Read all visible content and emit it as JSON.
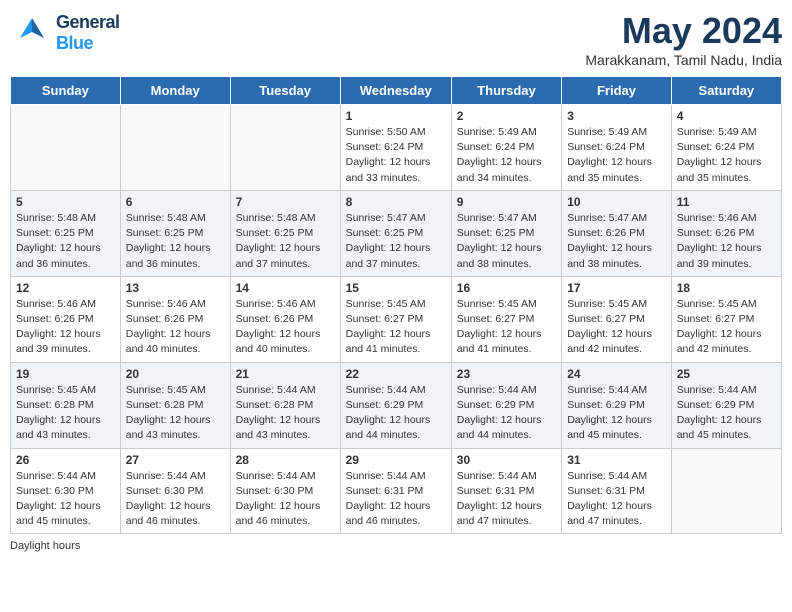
{
  "header": {
    "logo_line1": "General",
    "logo_line2": "Blue",
    "month_year": "May 2024",
    "location": "Marakkanam, Tamil Nadu, India"
  },
  "days_of_week": [
    "Sunday",
    "Monday",
    "Tuesday",
    "Wednesday",
    "Thursday",
    "Friday",
    "Saturday"
  ],
  "footer": {
    "daylight_label": "Daylight hours"
  },
  "weeks": [
    {
      "days": [
        {
          "num": "",
          "info": "",
          "week_class": "empty"
        },
        {
          "num": "",
          "info": "",
          "week_class": "empty"
        },
        {
          "num": "",
          "info": "",
          "week_class": "empty"
        },
        {
          "num": "1",
          "info": "Sunrise: 5:50 AM\nSunset: 6:24 PM\nDaylight: 12 hours\nand 33 minutes.",
          "week_class": "odd-week"
        },
        {
          "num": "2",
          "info": "Sunrise: 5:49 AM\nSunset: 6:24 PM\nDaylight: 12 hours\nand 34 minutes.",
          "week_class": "odd-week"
        },
        {
          "num": "3",
          "info": "Sunrise: 5:49 AM\nSunset: 6:24 PM\nDaylight: 12 hours\nand 35 minutes.",
          "week_class": "odd-week"
        },
        {
          "num": "4",
          "info": "Sunrise: 5:49 AM\nSunset: 6:24 PM\nDaylight: 12 hours\nand 35 minutes.",
          "week_class": "odd-week"
        }
      ]
    },
    {
      "days": [
        {
          "num": "5",
          "info": "Sunrise: 5:48 AM\nSunset: 6:25 PM\nDaylight: 12 hours\nand 36 minutes.",
          "week_class": "even-week"
        },
        {
          "num": "6",
          "info": "Sunrise: 5:48 AM\nSunset: 6:25 PM\nDaylight: 12 hours\nand 36 minutes.",
          "week_class": "even-week"
        },
        {
          "num": "7",
          "info": "Sunrise: 5:48 AM\nSunset: 6:25 PM\nDaylight: 12 hours\nand 37 minutes.",
          "week_class": "even-week"
        },
        {
          "num": "8",
          "info": "Sunrise: 5:47 AM\nSunset: 6:25 PM\nDaylight: 12 hours\nand 37 minutes.",
          "week_class": "even-week"
        },
        {
          "num": "9",
          "info": "Sunrise: 5:47 AM\nSunset: 6:25 PM\nDaylight: 12 hours\nand 38 minutes.",
          "week_class": "even-week"
        },
        {
          "num": "10",
          "info": "Sunrise: 5:47 AM\nSunset: 6:26 PM\nDaylight: 12 hours\nand 38 minutes.",
          "week_class": "even-week"
        },
        {
          "num": "11",
          "info": "Sunrise: 5:46 AM\nSunset: 6:26 PM\nDaylight: 12 hours\nand 39 minutes.",
          "week_class": "even-week"
        }
      ]
    },
    {
      "days": [
        {
          "num": "12",
          "info": "Sunrise: 5:46 AM\nSunset: 6:26 PM\nDaylight: 12 hours\nand 39 minutes.",
          "week_class": "odd-week"
        },
        {
          "num": "13",
          "info": "Sunrise: 5:46 AM\nSunset: 6:26 PM\nDaylight: 12 hours\nand 40 minutes.",
          "week_class": "odd-week"
        },
        {
          "num": "14",
          "info": "Sunrise: 5:46 AM\nSunset: 6:26 PM\nDaylight: 12 hours\nand 40 minutes.",
          "week_class": "odd-week"
        },
        {
          "num": "15",
          "info": "Sunrise: 5:45 AM\nSunset: 6:27 PM\nDaylight: 12 hours\nand 41 minutes.",
          "week_class": "odd-week"
        },
        {
          "num": "16",
          "info": "Sunrise: 5:45 AM\nSunset: 6:27 PM\nDaylight: 12 hours\nand 41 minutes.",
          "week_class": "odd-week"
        },
        {
          "num": "17",
          "info": "Sunrise: 5:45 AM\nSunset: 6:27 PM\nDaylight: 12 hours\nand 42 minutes.",
          "week_class": "odd-week"
        },
        {
          "num": "18",
          "info": "Sunrise: 5:45 AM\nSunset: 6:27 PM\nDaylight: 12 hours\nand 42 minutes.",
          "week_class": "odd-week"
        }
      ]
    },
    {
      "days": [
        {
          "num": "19",
          "info": "Sunrise: 5:45 AM\nSunset: 6:28 PM\nDaylight: 12 hours\nand 43 minutes.",
          "week_class": "even-week"
        },
        {
          "num": "20",
          "info": "Sunrise: 5:45 AM\nSunset: 6:28 PM\nDaylight: 12 hours\nand 43 minutes.",
          "week_class": "even-week"
        },
        {
          "num": "21",
          "info": "Sunrise: 5:44 AM\nSunset: 6:28 PM\nDaylight: 12 hours\nand 43 minutes.",
          "week_class": "even-week"
        },
        {
          "num": "22",
          "info": "Sunrise: 5:44 AM\nSunset: 6:29 PM\nDaylight: 12 hours\nand 44 minutes.",
          "week_class": "even-week"
        },
        {
          "num": "23",
          "info": "Sunrise: 5:44 AM\nSunset: 6:29 PM\nDaylight: 12 hours\nand 44 minutes.",
          "week_class": "even-week"
        },
        {
          "num": "24",
          "info": "Sunrise: 5:44 AM\nSunset: 6:29 PM\nDaylight: 12 hours\nand 45 minutes.",
          "week_class": "even-week"
        },
        {
          "num": "25",
          "info": "Sunrise: 5:44 AM\nSunset: 6:29 PM\nDaylight: 12 hours\nand 45 minutes.",
          "week_class": "even-week"
        }
      ]
    },
    {
      "days": [
        {
          "num": "26",
          "info": "Sunrise: 5:44 AM\nSunset: 6:30 PM\nDaylight: 12 hours\nand 45 minutes.",
          "week_class": "odd-week"
        },
        {
          "num": "27",
          "info": "Sunrise: 5:44 AM\nSunset: 6:30 PM\nDaylight: 12 hours\nand 46 minutes.",
          "week_class": "odd-week"
        },
        {
          "num": "28",
          "info": "Sunrise: 5:44 AM\nSunset: 6:30 PM\nDaylight: 12 hours\nand 46 minutes.",
          "week_class": "odd-week"
        },
        {
          "num": "29",
          "info": "Sunrise: 5:44 AM\nSunset: 6:31 PM\nDaylight: 12 hours\nand 46 minutes.",
          "week_class": "odd-week"
        },
        {
          "num": "30",
          "info": "Sunrise: 5:44 AM\nSunset: 6:31 PM\nDaylight: 12 hours\nand 47 minutes.",
          "week_class": "odd-week"
        },
        {
          "num": "31",
          "info": "Sunrise: 5:44 AM\nSunset: 6:31 PM\nDaylight: 12 hours\nand 47 minutes.",
          "week_class": "odd-week"
        },
        {
          "num": "",
          "info": "",
          "week_class": "empty"
        }
      ]
    }
  ]
}
